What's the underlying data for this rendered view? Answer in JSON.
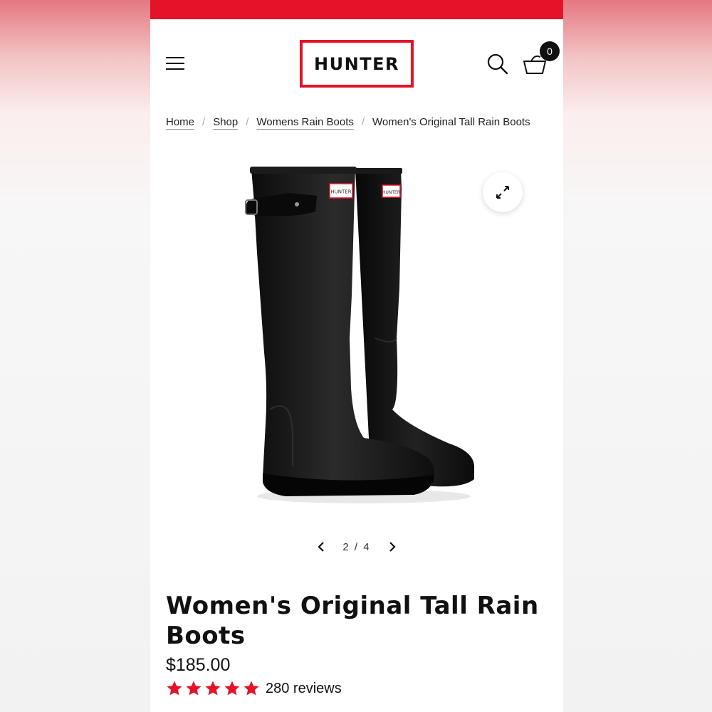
{
  "brand": {
    "logo_text": "HUNTER",
    "accent_color": "#e5132a"
  },
  "header": {
    "menu_icon": "hamburger-icon",
    "search_icon": "search-icon",
    "cart_icon": "basket-icon",
    "cart_count": "0"
  },
  "breadcrumb": {
    "items": [
      "Home",
      "Shop",
      "Womens Rain Boots"
    ],
    "current": "Women's Original Tall Rain Boots",
    "separator": "/"
  },
  "gallery": {
    "counter": "2 / 4",
    "boot_label": "HUNTER",
    "prev_icon": "chevron-left-icon",
    "next_icon": "chevron-right-icon",
    "expand_icon": "expand-icon"
  },
  "product": {
    "title": "Women's Original Tall Rain Boots",
    "price": "$185.00",
    "rating": 5,
    "rating_color": "#e5132a",
    "reviews": "280 reviews"
  }
}
